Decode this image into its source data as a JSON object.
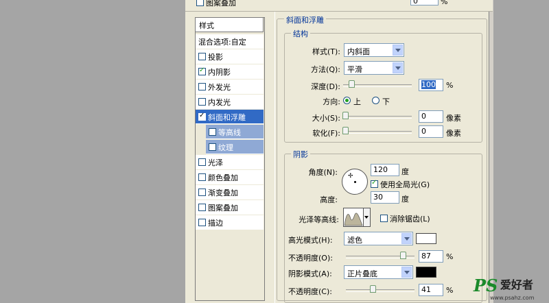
{
  "top": {
    "prev_item": "图案叠加",
    "prev_field_value": "0",
    "prev_unit": "%"
  },
  "styles_panel": {
    "header": "样式",
    "blend_options": "混合选项:自定",
    "items": [
      {
        "label": "投影",
        "checked": false
      },
      {
        "label": "内阴影",
        "checked": true
      },
      {
        "label": "外发光",
        "checked": false
      },
      {
        "label": "内发光",
        "checked": false
      },
      {
        "label": "斜面和浮雕",
        "checked": true,
        "selected": true
      },
      {
        "label": "等高线",
        "checked": false,
        "sub": true
      },
      {
        "label": "纹理",
        "checked": false,
        "sub": true
      },
      {
        "label": "光泽",
        "checked": false
      },
      {
        "label": "颜色叠加",
        "checked": false
      },
      {
        "label": "渐变叠加",
        "checked": false
      },
      {
        "label": "图案叠加",
        "checked": false
      },
      {
        "label": "描边",
        "checked": false
      }
    ]
  },
  "bevel": {
    "title": "斜面和浮雕",
    "structure": {
      "title": "结构",
      "style_label": "样式(T):",
      "style_value": "内斜面",
      "technique_label": "方法(Q):",
      "technique_value": "平滑",
      "depth_label": "深度(D):",
      "depth_value": "100",
      "depth_unit": "%",
      "direction_label": "方向:",
      "dir_up": "上",
      "dir_down": "下",
      "size_label": "大小(S):",
      "size_value": "0",
      "size_unit": "像素",
      "soften_label": "软化(F):",
      "soften_value": "0",
      "soften_unit": "像素"
    },
    "shading": {
      "title": "阴影",
      "angle_label": "角度(N):",
      "angle_value": "120",
      "angle_unit": "度",
      "global_light": "使用全局光(G)",
      "altitude_label": "高度:",
      "altitude_value": "30",
      "altitude_unit": "度",
      "gloss_label": "光泽等高线:",
      "antialias": "消除锯齿(L)",
      "highlight_mode_label": "高光模式(H):",
      "highlight_mode_value": "滤色",
      "highlight_color": "#ffffff",
      "highlight_opacity_label": "不透明度(O):",
      "highlight_opacity_value": "87",
      "shadow_mode_label": "阴影模式(A):",
      "shadow_mode_value": "正片叠底",
      "shadow_color": "#000000",
      "shadow_opacity_label": "不透明度(C):",
      "shadow_opacity_value": "41",
      "pct": "%"
    }
  },
  "watermark": {
    "brand_ps": "PS",
    "brand_cn": "爱好者",
    "url": "www.psahz.com"
  },
  "colors": {
    "accent": "#316ac5",
    "legend": "#003399"
  }
}
